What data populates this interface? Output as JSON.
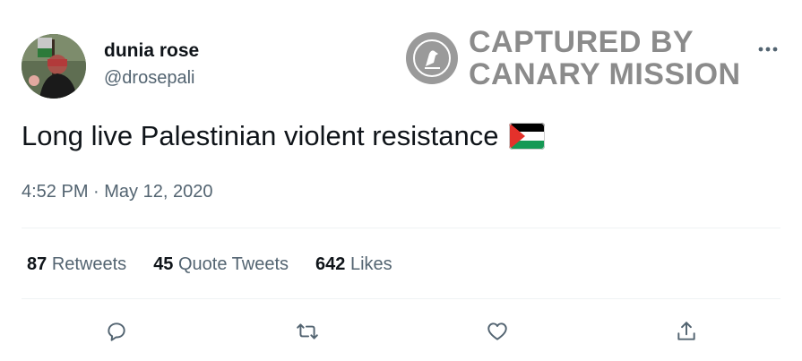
{
  "user": {
    "name": "dunia rose",
    "handle": "@drosepali"
  },
  "watermark": {
    "line1": "CAPTURED BY",
    "line2": "CANARY MISSION"
  },
  "tweet": {
    "text": "Long live Palestinian violent resistance",
    "timestamp": "4:52 PM · May 12, 2020"
  },
  "stats": {
    "retweets_count": "87",
    "retweets_label": "Retweets",
    "quotes_count": "45",
    "quotes_label": "Quote Tweets",
    "likes_count": "642",
    "likes_label": "Likes"
  },
  "actions": [
    "reply-icon",
    "retweet-icon",
    "like-icon",
    "share-icon"
  ],
  "colors": {
    "text": "#0f1419",
    "secondary": "#536471",
    "divider": "#eff3f4",
    "watermark": "#8b8b8b"
  }
}
